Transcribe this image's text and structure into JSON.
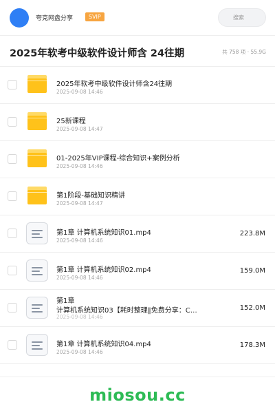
{
  "header": {
    "brand": "夸克网盘分享",
    "badge": "SVIP",
    "search_placeholder": "搜索"
  },
  "folder_title": "2025年软考中级软件设计师含 24往期",
  "stats": "共 758 项 · 55.9G",
  "items": [
    {
      "type": "folder",
      "name": "2025年软考中级软件设计师含24往期",
      "date": "2025-09-08 14:46",
      "size": ""
    },
    {
      "type": "folder",
      "name": "25新课程",
      "date": "2025-09-08 14:47",
      "size": ""
    },
    {
      "type": "folder",
      "name": "01-2025年VIP课程-综合知识+案例分析",
      "date": "2025-09-08 14:46",
      "size": ""
    },
    {
      "type": "folder",
      "name": "第1阶段-基础知识精讲",
      "date": "2025-09-08 14:47",
      "size": ""
    },
    {
      "type": "file",
      "name": "第1章 计算机系统知识01.mp4",
      "date": "2025-09-08 14:46",
      "size": "223.8M"
    },
    {
      "type": "file",
      "name": "第1章 计算机系统知识02.mp4",
      "date": "2025-09-08 14:46",
      "size": "159.0M"
    },
    {
      "type": "file",
      "name_line1": "第1章",
      "name_line2": "计算机系统知识03【耗时整理‖免费分享：C…",
      "date": "2025-09-08 14:46",
      "size": "152.0M"
    },
    {
      "type": "file",
      "name": "第1章 计算机系统知识04.mp4",
      "date": "2025-09-08 14:46",
      "size": "178.3M"
    }
  ],
  "watermark": "miosou.cc",
  "colors": {
    "avatar": "#2f7ff5",
    "svip_badge": "#f7a540",
    "folder": "#ffc21a",
    "watermark": "#2dbb55"
  }
}
